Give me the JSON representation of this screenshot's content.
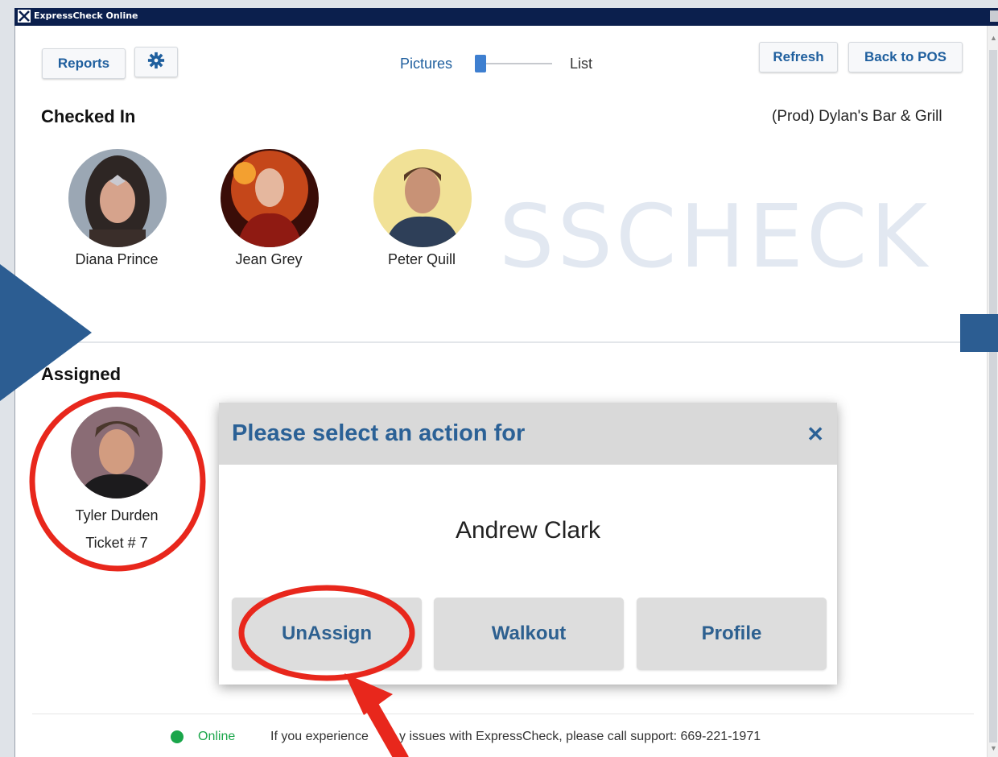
{
  "window": {
    "title": "ExpressCheck Online"
  },
  "toolbar": {
    "reports_label": "Reports",
    "settings_icon": "gear-icon",
    "view_left_label": "Pictures",
    "view_right_label": "List",
    "view_slider_level": 0,
    "refresh_label": "Refresh",
    "back_label": "Back to POS"
  },
  "checked_in": {
    "title": "Checked In",
    "location": "(Prod) Dylan's Bar & Grill",
    "people": [
      {
        "name": "Diana Prince"
      },
      {
        "name": "Jean Grey"
      },
      {
        "name": "Peter Quill"
      }
    ]
  },
  "watermark": "SSCHECK",
  "assigned": {
    "title": "Assigned",
    "people": [
      {
        "name": "Tyler Durden",
        "ticket": "Ticket # 7"
      }
    ]
  },
  "dialog": {
    "title": "Please select an action for",
    "close_icon": "close-icon",
    "person": "Andrew Clark",
    "buttons": [
      {
        "label": "UnAssign"
      },
      {
        "label": "Walkout"
      },
      {
        "label": "Profile"
      }
    ]
  },
  "status": {
    "state": "Online",
    "message": "If you experience",
    "message_end": "y issues with ExpressCheck, please call support: 669-221-1971"
  },
  "colors": {
    "accent": "#2b6196",
    "annotation_red": "#e8271c",
    "titlebar": "#0b1f4d",
    "online": "#1aa64a",
    "annotation_arrow_blue": "#2c5d92"
  }
}
